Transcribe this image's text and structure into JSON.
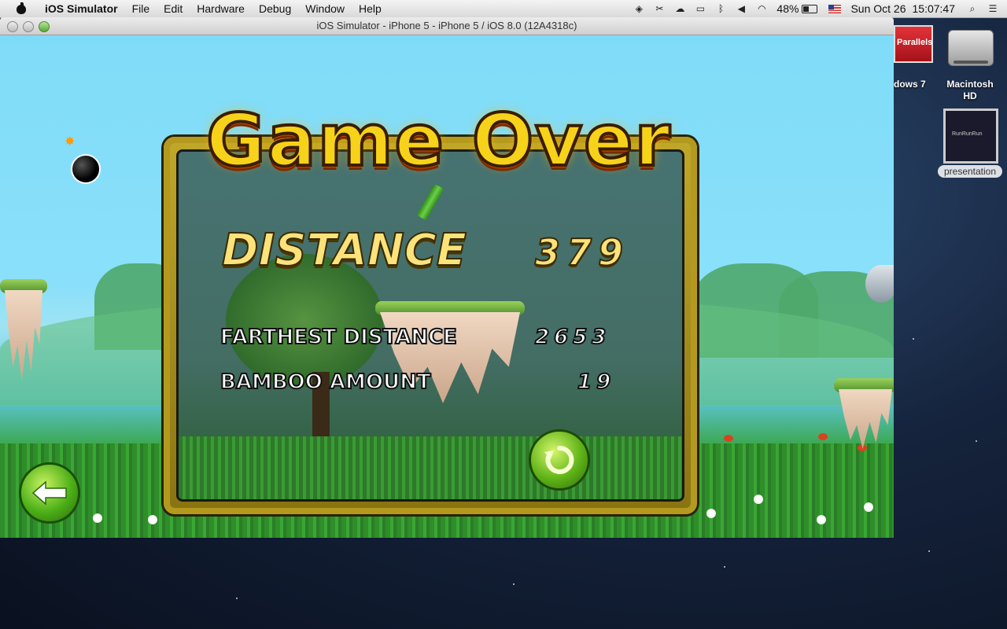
{
  "menubar": {
    "app_name": "iOS Simulator",
    "items": [
      "File",
      "Edit",
      "Hardware",
      "Debug",
      "Window",
      "Help"
    ],
    "battery_percent": "48%",
    "date": "Sun Oct 26",
    "time": "15:07:47"
  },
  "window": {
    "title": "iOS Simulator - iPhone 5 - iPhone 5 / iOS 8.0 (12A4318c)"
  },
  "game": {
    "title": "Game Over",
    "distance_label": "DISTANCE",
    "distance_value": "379",
    "farthest_label": "FARTHEST DISTANCE",
    "farthest_value": "2653",
    "bamboo_label": "BAMBOO AMOUNT",
    "bamboo_value": "19"
  },
  "desktop_icons": {
    "parallels_label": "Parallels",
    "windows_label": "dows 7",
    "hd_label_line1": "Macintosh",
    "hd_label_line2": "HD",
    "presentation_label": "presentation"
  },
  "colors": {
    "title_fill": "#f7d21a",
    "panel_frame": "#b39a1e",
    "button_green": "#5fb317"
  },
  "icons": [
    "apple-icon",
    "dropbox-icon",
    "scissors-icon",
    "cloud-icon",
    "airplay-icon",
    "bluetooth-icon",
    "volume-icon",
    "wifi-icon",
    "battery-icon",
    "flag-icon",
    "search-icon",
    "list-icon",
    "bomb-icon",
    "bamboo-icon",
    "replay-icon",
    "back-arrow-icon",
    "bird-icon"
  ]
}
